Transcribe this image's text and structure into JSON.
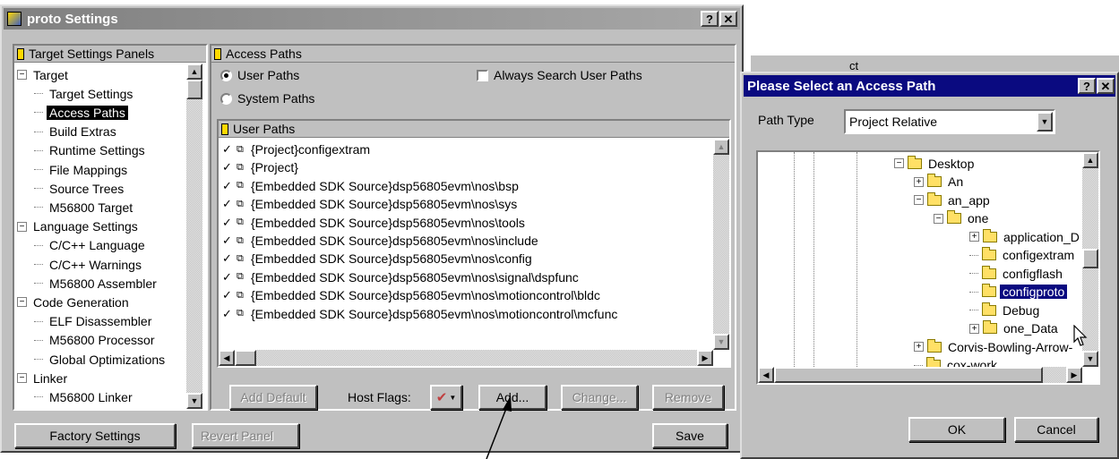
{
  "settings_window": {
    "title": "proto Settings",
    "help_btn": "?",
    "close_btn": "✕",
    "panels_header": "Target Settings Panels",
    "panel_tree": [
      {
        "label": "Target",
        "type": "group"
      },
      {
        "label": "Target Settings",
        "type": "item"
      },
      {
        "label": "Access Paths",
        "type": "item",
        "selected": true
      },
      {
        "label": "Build Extras",
        "type": "item"
      },
      {
        "label": "Runtime Settings",
        "type": "item"
      },
      {
        "label": "File Mappings",
        "type": "item"
      },
      {
        "label": "Source Trees",
        "type": "item"
      },
      {
        "label": "M56800 Target",
        "type": "item"
      },
      {
        "label": "Language Settings",
        "type": "group"
      },
      {
        "label": "C/C++ Language",
        "type": "item"
      },
      {
        "label": "C/C++ Warnings",
        "type": "item"
      },
      {
        "label": "M56800 Assembler",
        "type": "item"
      },
      {
        "label": "Code Generation",
        "type": "group"
      },
      {
        "label": "ELF Disassembler",
        "type": "item"
      },
      {
        "label": "M56800 Processor",
        "type": "item"
      },
      {
        "label": "Global Optimizations",
        "type": "item"
      },
      {
        "label": "Linker",
        "type": "group"
      },
      {
        "label": "M56800 Linker",
        "type": "item"
      }
    ],
    "panel_title": "Access Paths",
    "radio_user": "User Paths",
    "radio_system": "System Paths",
    "always_search": "Always Search User Paths",
    "list_header": "User Paths",
    "paths": [
      "{Project}configextram",
      "{Project}",
      "{Embedded SDK Source}dsp56805evm\\nos\\bsp",
      "{Embedded SDK Source}dsp56805evm\\nos\\sys",
      "{Embedded SDK Source}dsp56805evm\\nos\\tools",
      "{Embedded SDK Source}dsp56805evm\\nos\\include",
      "{Embedded SDK Source}dsp56805evm\\nos\\config",
      "{Embedded SDK Source}dsp56805evm\\nos\\signal\\dspfunc",
      "{Embedded SDK Source}dsp56805evm\\nos\\motioncontrol\\bldc",
      "{Embedded SDK Source}dsp56805evm\\nos\\motioncontrol\\mcfunc"
    ],
    "btn_add_default": "Add Default",
    "host_flags_label": "Host Flags:",
    "btn_add": "Add...",
    "btn_change": "Change...",
    "btn_remove": "Remove",
    "btn_factory": "Factory Settings",
    "btn_revert": "Revert Panel",
    "btn_save": "Save"
  },
  "path_dialog": {
    "title": "Please Select an Access Path",
    "help_btn": "?",
    "close_btn": "✕",
    "behind_text": "ct",
    "path_type_label": "Path Type",
    "path_type_value": "Project Relative",
    "folders": [
      {
        "label": "Desktop",
        "expander": "−",
        "level": 0
      },
      {
        "label": "An",
        "expander": "+",
        "level": 1
      },
      {
        "label": "an_app",
        "expander": "−",
        "level": 1
      },
      {
        "label": "one",
        "expander": "−",
        "level": 2
      },
      {
        "label": "application_D",
        "expander": "+",
        "level": 3
      },
      {
        "label": "configextram",
        "expander": "",
        "level": 3
      },
      {
        "label": "configflash",
        "expander": "",
        "level": 3
      },
      {
        "label": "configproto",
        "expander": "",
        "level": 3,
        "selected": true
      },
      {
        "label": "Debug",
        "expander": "",
        "level": 3
      },
      {
        "label": "one_Data",
        "expander": "+",
        "level": 3
      },
      {
        "label": "Corvis-Bowling-Arrow-",
        "expander": "+",
        "level": 1
      },
      {
        "label": "cox-work",
        "expander": "",
        "level": 1
      }
    ],
    "btn_ok": "OK",
    "btn_cancel": "Cancel"
  }
}
